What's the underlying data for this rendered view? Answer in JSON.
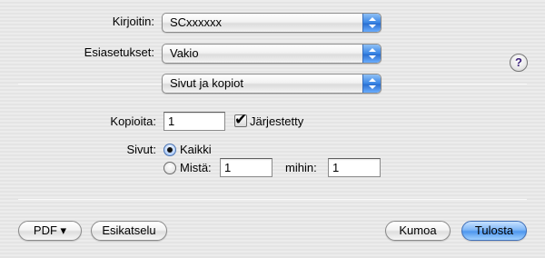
{
  "printer": {
    "label": "Kirjoitin:",
    "value": "SCxxxxxx"
  },
  "presets": {
    "label": "Esiasetukset:",
    "value": "Vakio"
  },
  "help": {
    "glyph": "?"
  },
  "panel": {
    "value": "Sivut ja kopiot"
  },
  "copies": {
    "label": "Kopioita:",
    "value": "1",
    "collated_label": "Järjestetty",
    "collated_checked": true
  },
  "pages": {
    "label": "Sivut:",
    "all_label": "Kaikki",
    "range_from_label": "Mistä:",
    "from_value": "1",
    "to_label": "mihin:",
    "to_value": "1",
    "selected": "all"
  },
  "buttons": {
    "pdf": "PDF ▾",
    "preview": "Esikatselu",
    "cancel": "Kumoa",
    "print": "Tulosta"
  },
  "colors": {
    "accent_blue": "#3a86e6",
    "default_button": "#6aaeff"
  },
  "icons": {
    "popup_arrows": "updown-arrows-icon",
    "help": "help-icon",
    "checkmark": "checkmark-icon"
  }
}
